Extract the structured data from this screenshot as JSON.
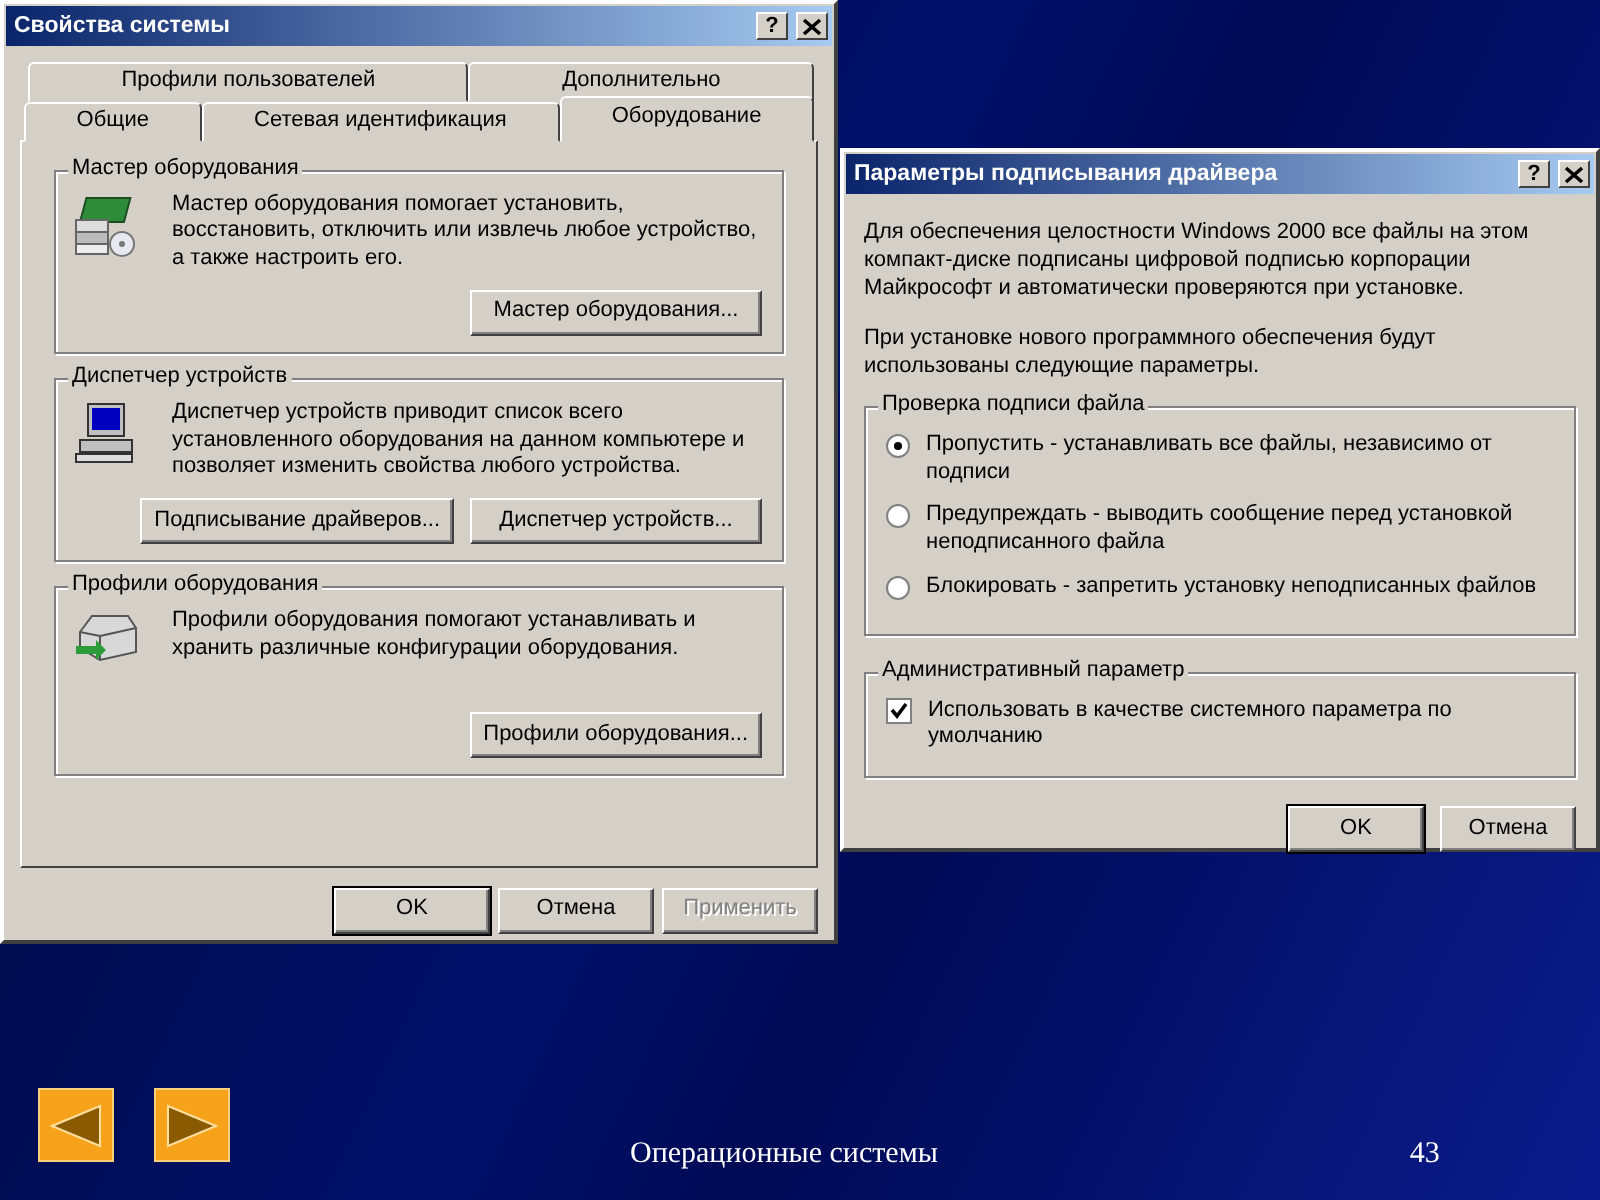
{
  "system_properties": {
    "title": "Свойства системы",
    "help_button": "?",
    "tab_rows": [
      [
        {
          "label": "Профили пользователей",
          "selected": false
        },
        {
          "label": "Дополнительно",
          "selected": false
        }
      ],
      [
        {
          "label": "Общие",
          "selected": false
        },
        {
          "label": "Сетевая идентификация",
          "selected": false
        },
        {
          "label": "Оборудование",
          "selected": true
        }
      ]
    ],
    "groups": [
      {
        "title": "Мастер оборудования",
        "kind": "wizard",
        "text": "Мастер оборудования помогает установить, восстановить, отключить или извлечь любое устройство, а также настроить его.",
        "buttons": [
          "Мастер оборудования..."
        ]
      },
      {
        "title": "Диспетчер устройств",
        "kind": "computer",
        "text": "Диспетчер устройств приводит список всего установленного оборудования на данном компьютере и позволяет изменить свойства любого устройства.",
        "buttons": [
          "Подписывание драйверов...",
          "Диспетчер устройств..."
        ]
      },
      {
        "title": "Профили оборудования",
        "kind": "profiles",
        "text": "Профили оборудования помогают устанавливать и хранить различные конфигурации оборудования.",
        "buttons": [
          "Профили оборудования..."
        ]
      }
    ],
    "buttons": [
      {
        "label": "OK",
        "default": true,
        "disabled": false
      },
      {
        "label": "Отмена",
        "default": false,
        "disabled": false
      },
      {
        "label": "Применить",
        "default": false,
        "disabled": true
      }
    ]
  },
  "driver_signing": {
    "title": "Параметры подписывания драйвера",
    "help_button": "?",
    "paragraphs": [
      "Для обеспечения целостности Windows 2000 все файлы на этом компакт-диске подписаны цифровой подписью корпорации Майкрософт и автоматически проверяются при установке.",
      "При установке нового программного обеспечения будут использованы следующие параметры."
    ],
    "groups": [
      {
        "title": "Проверка подписи файла",
        "kind": "radio",
        "options": [
          {
            "label": "Пропустить - устанавливать все файлы, независимо от подписи",
            "selected": true
          },
          {
            "label": "Предупреждать - выводить сообщение перед установкой неподписанного файла",
            "selected": false
          },
          {
            "label": "Блокировать - запретить установку неподписанных файлов",
            "selected": false
          }
        ]
      },
      {
        "title": "Административный параметр",
        "kind": "checkbox",
        "options": [
          {
            "label": "Использовать в качестве системного параметра по умолчанию",
            "checked": true
          }
        ]
      }
    ],
    "buttons": [
      {
        "label": "OK",
        "default": true,
        "disabled": false
      },
      {
        "label": "Отмена",
        "default": false,
        "disabled": false
      }
    ]
  },
  "slide": {
    "nav_buttons": [
      {
        "kind": "back"
      },
      {
        "kind": "forward"
      }
    ],
    "footer": "Операционные системы",
    "page_number": "43"
  }
}
